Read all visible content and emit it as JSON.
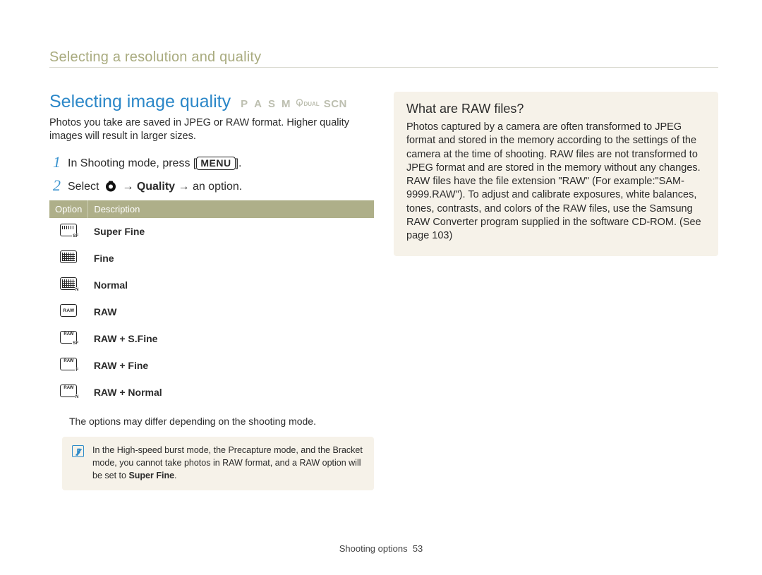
{
  "breadcrumb": "Selecting a resolution and quality",
  "heading": "Selecting image quality",
  "modes": {
    "p": "P",
    "a": "A",
    "s": "S",
    "m": "M",
    "dual": "DUAL",
    "scn": "SCN"
  },
  "intro": "Photos you take are saved in JPEG or RAW format. Higher quality images will result in larger sizes.",
  "steps": {
    "s1_num": "1",
    "s1_a": "In Shooting mode, press [",
    "s1_menu": "MENU",
    "s1_b": "].",
    "s2_num": "2",
    "s2_a": "Select ",
    "s2_b": " → ",
    "s2_quality": "Quality",
    "s2_c": " → an option."
  },
  "table": {
    "headers": {
      "c1": "Option",
      "c2": "Description"
    },
    "rows": [
      {
        "label": "Super Fine",
        "icon": "grid-sf fill-top"
      },
      {
        "label": "Fine",
        "icon": "fill-mid"
      },
      {
        "label": "Normal",
        "icon": "fill-mid fill-n"
      },
      {
        "label": "RAW",
        "icon": "raw"
      },
      {
        "label": "RAW + S.Fine",
        "icon": "raw-sf"
      },
      {
        "label": "RAW + Fine",
        "icon": "raw-f"
      },
      {
        "label": "RAW + Normal",
        "icon": "raw-n"
      }
    ]
  },
  "footnote": "The options may differ depending on the shooting mode.",
  "note": {
    "text": "In the High-speed burst mode, the Precapture mode, and the Bracket mode, you cannot take photos in RAW format, and a RAW option will be set to ",
    "bold": "Super Fine",
    "after": "."
  },
  "sidebox": {
    "title": "What are RAW ﬁles?",
    "body": "Photos captured by a camera are often transformed to JPEG format and stored in the memory according to the settings of the camera at the time of shooting. RAW files are not transformed to JPEG format and are stored in the memory without any changes. RAW files have the file extension \"RAW\" (For example:\"SAM-9999.RAW\"). To adjust and calibrate exposures, white balances, tones, contrasts, and colors of the RAW files, use the Samsung RAW Converter program supplied in the software CD-ROM. (See page 103)"
  },
  "footer": {
    "label": "Shooting options",
    "page": "53"
  }
}
